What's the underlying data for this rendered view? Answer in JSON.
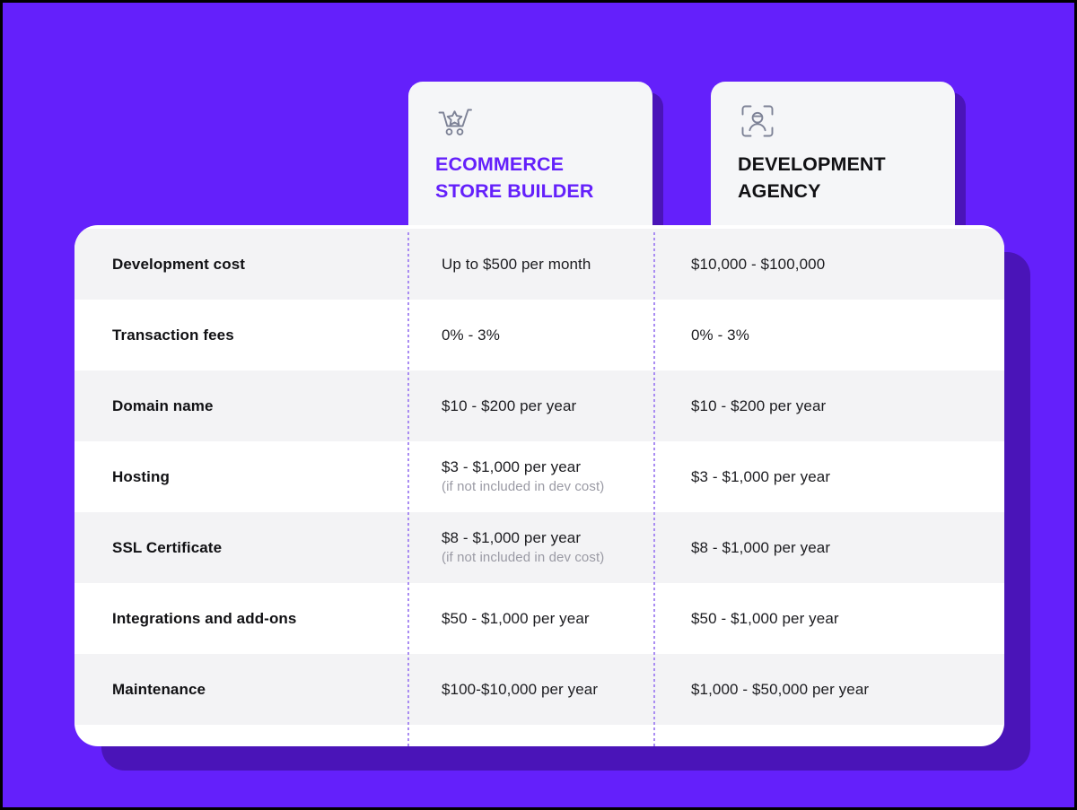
{
  "theme": {
    "background": "#6420fb",
    "shadow": "#4a14b8",
    "accent": "#6420fb",
    "card_bg": "#f5f6f8",
    "row_shaded": "#f3f3f5",
    "row_plain": "#ffffff",
    "label_color": "#111114",
    "subtext_color": "#9a9aa4",
    "divider_color": "#a98cf2"
  },
  "columns": [
    {
      "id": "feature",
      "label": "",
      "icon": ""
    },
    {
      "id": "ecommerce_store_builder",
      "label": "ECOMMERCE\nSTORE BUILDER",
      "icon": "shopping-cart-star-icon",
      "title_style": "accent"
    },
    {
      "id": "development_agency",
      "label": "DEVELOPMENT\nAGENCY",
      "icon": "person-scan-icon",
      "title_style": "dark"
    }
  ],
  "rows": [
    {
      "feature": "Development cost",
      "builder": {
        "main": "Up to $500 per month",
        "sub": ""
      },
      "agency": {
        "main": "$10,000 - $100,000",
        "sub": ""
      }
    },
    {
      "feature": "Transaction fees",
      "builder": {
        "main": "0% - 3%",
        "sub": ""
      },
      "agency": {
        "main": "0% - 3%",
        "sub": ""
      }
    },
    {
      "feature": "Domain name",
      "builder": {
        "main": "$10 - $200 per year",
        "sub": ""
      },
      "agency": {
        "main": "$10 - $200 per year",
        "sub": ""
      }
    },
    {
      "feature": "Hosting",
      "builder": {
        "main": "$3 - $1,000 per year",
        "sub": "(if not included in dev cost)"
      },
      "agency": {
        "main": "$3 - $1,000 per year",
        "sub": ""
      }
    },
    {
      "feature": "SSL Certificate",
      "builder": {
        "main": "$8 - $1,000 per year",
        "sub": "(if not included in dev cost)"
      },
      "agency": {
        "main": "$8 - $1,000 per year",
        "sub": ""
      }
    },
    {
      "feature": "Integrations and add-ons",
      "builder": {
        "main": "$50 - $1,000 per year",
        "sub": ""
      },
      "agency": {
        "main": "$50 - $1,000 per year",
        "sub": ""
      }
    },
    {
      "feature": "Maintenance",
      "builder": {
        "main": "$100-$10,000 per year",
        "sub": ""
      },
      "agency": {
        "main": "$1,000 - $50,000 per year",
        "sub": ""
      }
    }
  ]
}
